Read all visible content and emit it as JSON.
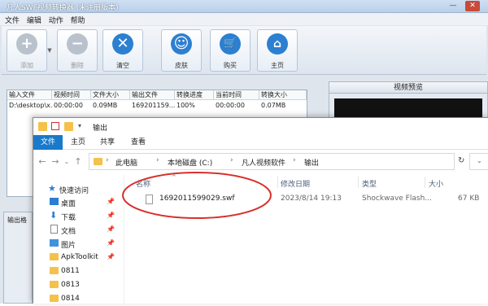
{
  "app": {
    "title": "凡人SWF视频转换器  (未注册版本)",
    "menu": [
      "文件",
      "编辑",
      "动作",
      "帮助"
    ],
    "toolbar": [
      {
        "label": "添加",
        "icon": "add-icon",
        "enabled": false
      },
      {
        "label": "删除",
        "icon": "remove-icon",
        "enabled": false
      },
      {
        "label": "清空",
        "icon": "clear-icon",
        "enabled": true
      },
      {
        "label": "皮肤",
        "icon": "skin-smiley-icon",
        "enabled": true
      },
      {
        "label": "购买",
        "icon": "cart-icon",
        "enabled": true
      },
      {
        "label": "主页",
        "icon": "home-icon",
        "enabled": true
      }
    ],
    "grid": {
      "headers": [
        "输入文件",
        "视频时间",
        "文件大小",
        "输出文件",
        "转换进度",
        "当前时间",
        "转换大小"
      ],
      "rows": [
        [
          "D:\\desktop\\x...",
          "00:00:00",
          "0.09MB",
          "169201159...",
          "100%",
          "00:00:00",
          "0.07MB"
        ]
      ]
    },
    "preview_title": "视频预览",
    "output_label": "输出格"
  },
  "explorer": {
    "title": "输出",
    "ribbon_tabs": [
      "文件",
      "主页",
      "共享",
      "查看"
    ],
    "breadcrumb": [
      "此电脑",
      "本地磁盘 (C:)",
      "凡人视频软件",
      "输出"
    ],
    "nav": {
      "quick_access": "快速访问",
      "items": [
        {
          "label": "桌面",
          "pinned": true,
          "icon": "desktop-icon"
        },
        {
          "label": "下载",
          "pinned": true,
          "icon": "download-icon"
        },
        {
          "label": "文档",
          "pinned": true,
          "icon": "documents-icon"
        },
        {
          "label": "图片",
          "pinned": true,
          "icon": "pictures-icon"
        },
        {
          "label": "ApkToolkit",
          "pinned": true,
          "icon": "folder-icon"
        },
        {
          "label": "0811",
          "pinned": false,
          "icon": "folder-icon"
        },
        {
          "label": "0813",
          "pinned": false,
          "icon": "folder-icon"
        },
        {
          "label": "0814",
          "pinned": false,
          "icon": "folder-icon"
        }
      ]
    },
    "columns": [
      "名称",
      "修改日期",
      "类型",
      "大小"
    ],
    "files": [
      {
        "name": "1692011599029.swf",
        "modified": "2023/8/14 19:13",
        "type": "Shockwave Flash...",
        "size": "67 KB"
      }
    ],
    "highlight_color": "#d9302b"
  }
}
